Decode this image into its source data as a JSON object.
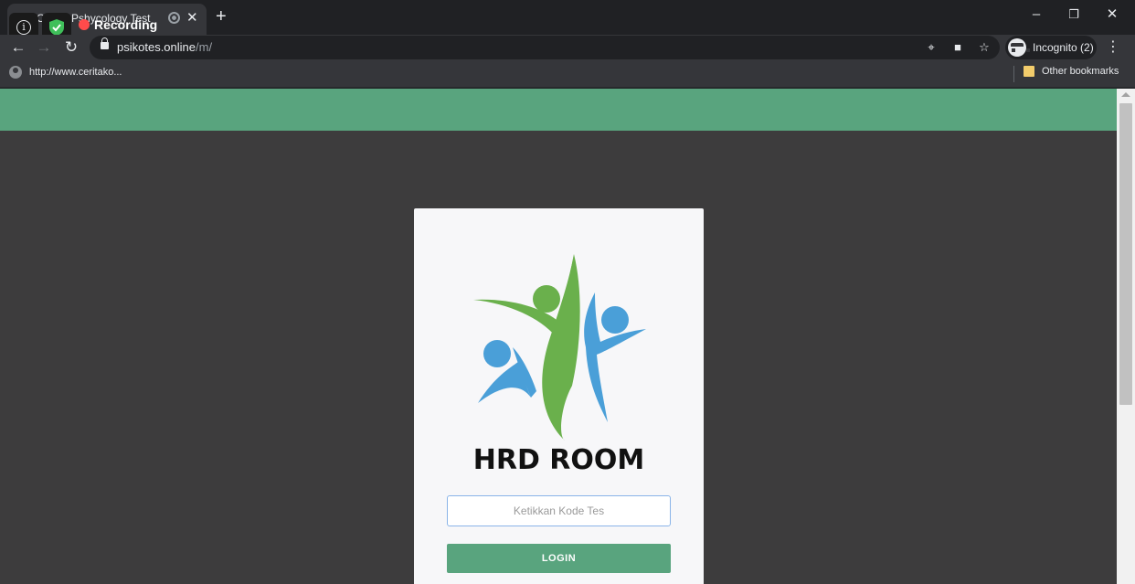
{
  "tab": {
    "title": "Online Pshycology Test"
  },
  "recording": {
    "label": "Recording"
  },
  "toolbar": {
    "url_host": "psikotes.online",
    "url_path": "/m/",
    "profile_label": "Incognito (2)"
  },
  "bookmarks": {
    "items": [
      {
        "label": "http://www.ceritako..."
      }
    ],
    "other_label": "Other bookmarks"
  },
  "page": {
    "brand": "HRD ROOM",
    "code_input": {
      "placeholder": "Ketikkan Kode Tes",
      "value": ""
    },
    "login_label": "LOGIN"
  },
  "colors": {
    "header_green": "#59a47e",
    "page_background": "#3d3c3d",
    "logo_green": "#6ab04c",
    "logo_blue": "#4a9fd8"
  }
}
